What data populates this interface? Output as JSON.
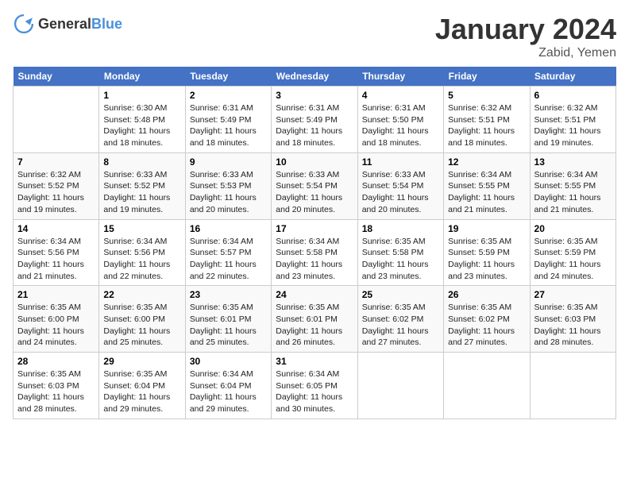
{
  "header": {
    "logo_general": "General",
    "logo_blue": "Blue",
    "month": "January 2024",
    "location": "Zabid, Yemen"
  },
  "days_of_week": [
    "Sunday",
    "Monday",
    "Tuesday",
    "Wednesday",
    "Thursday",
    "Friday",
    "Saturday"
  ],
  "weeks": [
    [
      {
        "day": "",
        "sunrise": "",
        "sunset": "",
        "daylight": ""
      },
      {
        "day": "1",
        "sunrise": "Sunrise: 6:30 AM",
        "sunset": "Sunset: 5:48 PM",
        "daylight": "Daylight: 11 hours and 18 minutes."
      },
      {
        "day": "2",
        "sunrise": "Sunrise: 6:31 AM",
        "sunset": "Sunset: 5:49 PM",
        "daylight": "Daylight: 11 hours and 18 minutes."
      },
      {
        "day": "3",
        "sunrise": "Sunrise: 6:31 AM",
        "sunset": "Sunset: 5:49 PM",
        "daylight": "Daylight: 11 hours and 18 minutes."
      },
      {
        "day": "4",
        "sunrise": "Sunrise: 6:31 AM",
        "sunset": "Sunset: 5:50 PM",
        "daylight": "Daylight: 11 hours and 18 minutes."
      },
      {
        "day": "5",
        "sunrise": "Sunrise: 6:32 AM",
        "sunset": "Sunset: 5:51 PM",
        "daylight": "Daylight: 11 hours and 18 minutes."
      },
      {
        "day": "6",
        "sunrise": "Sunrise: 6:32 AM",
        "sunset": "Sunset: 5:51 PM",
        "daylight": "Daylight: 11 hours and 19 minutes."
      }
    ],
    [
      {
        "day": "7",
        "sunrise": "Sunrise: 6:32 AM",
        "sunset": "Sunset: 5:52 PM",
        "daylight": "Daylight: 11 hours and 19 minutes."
      },
      {
        "day": "8",
        "sunrise": "Sunrise: 6:33 AM",
        "sunset": "Sunset: 5:52 PM",
        "daylight": "Daylight: 11 hours and 19 minutes."
      },
      {
        "day": "9",
        "sunrise": "Sunrise: 6:33 AM",
        "sunset": "Sunset: 5:53 PM",
        "daylight": "Daylight: 11 hours and 20 minutes."
      },
      {
        "day": "10",
        "sunrise": "Sunrise: 6:33 AM",
        "sunset": "Sunset: 5:54 PM",
        "daylight": "Daylight: 11 hours and 20 minutes."
      },
      {
        "day": "11",
        "sunrise": "Sunrise: 6:33 AM",
        "sunset": "Sunset: 5:54 PM",
        "daylight": "Daylight: 11 hours and 20 minutes."
      },
      {
        "day": "12",
        "sunrise": "Sunrise: 6:34 AM",
        "sunset": "Sunset: 5:55 PM",
        "daylight": "Daylight: 11 hours and 21 minutes."
      },
      {
        "day": "13",
        "sunrise": "Sunrise: 6:34 AM",
        "sunset": "Sunset: 5:55 PM",
        "daylight": "Daylight: 11 hours and 21 minutes."
      }
    ],
    [
      {
        "day": "14",
        "sunrise": "Sunrise: 6:34 AM",
        "sunset": "Sunset: 5:56 PM",
        "daylight": "Daylight: 11 hours and 21 minutes."
      },
      {
        "day": "15",
        "sunrise": "Sunrise: 6:34 AM",
        "sunset": "Sunset: 5:56 PM",
        "daylight": "Daylight: 11 hours and 22 minutes."
      },
      {
        "day": "16",
        "sunrise": "Sunrise: 6:34 AM",
        "sunset": "Sunset: 5:57 PM",
        "daylight": "Daylight: 11 hours and 22 minutes."
      },
      {
        "day": "17",
        "sunrise": "Sunrise: 6:34 AM",
        "sunset": "Sunset: 5:58 PM",
        "daylight": "Daylight: 11 hours and 23 minutes."
      },
      {
        "day": "18",
        "sunrise": "Sunrise: 6:35 AM",
        "sunset": "Sunset: 5:58 PM",
        "daylight": "Daylight: 11 hours and 23 minutes."
      },
      {
        "day": "19",
        "sunrise": "Sunrise: 6:35 AM",
        "sunset": "Sunset: 5:59 PM",
        "daylight": "Daylight: 11 hours and 23 minutes."
      },
      {
        "day": "20",
        "sunrise": "Sunrise: 6:35 AM",
        "sunset": "Sunset: 5:59 PM",
        "daylight": "Daylight: 11 hours and 24 minutes."
      }
    ],
    [
      {
        "day": "21",
        "sunrise": "Sunrise: 6:35 AM",
        "sunset": "Sunset: 6:00 PM",
        "daylight": "Daylight: 11 hours and 24 minutes."
      },
      {
        "day": "22",
        "sunrise": "Sunrise: 6:35 AM",
        "sunset": "Sunset: 6:00 PM",
        "daylight": "Daylight: 11 hours and 25 minutes."
      },
      {
        "day": "23",
        "sunrise": "Sunrise: 6:35 AM",
        "sunset": "Sunset: 6:01 PM",
        "daylight": "Daylight: 11 hours and 25 minutes."
      },
      {
        "day": "24",
        "sunrise": "Sunrise: 6:35 AM",
        "sunset": "Sunset: 6:01 PM",
        "daylight": "Daylight: 11 hours and 26 minutes."
      },
      {
        "day": "25",
        "sunrise": "Sunrise: 6:35 AM",
        "sunset": "Sunset: 6:02 PM",
        "daylight": "Daylight: 11 hours and 27 minutes."
      },
      {
        "day": "26",
        "sunrise": "Sunrise: 6:35 AM",
        "sunset": "Sunset: 6:02 PM",
        "daylight": "Daylight: 11 hours and 27 minutes."
      },
      {
        "day": "27",
        "sunrise": "Sunrise: 6:35 AM",
        "sunset": "Sunset: 6:03 PM",
        "daylight": "Daylight: 11 hours and 28 minutes."
      }
    ],
    [
      {
        "day": "28",
        "sunrise": "Sunrise: 6:35 AM",
        "sunset": "Sunset: 6:03 PM",
        "daylight": "Daylight: 11 hours and 28 minutes."
      },
      {
        "day": "29",
        "sunrise": "Sunrise: 6:35 AM",
        "sunset": "Sunset: 6:04 PM",
        "daylight": "Daylight: 11 hours and 29 minutes."
      },
      {
        "day": "30",
        "sunrise": "Sunrise: 6:34 AM",
        "sunset": "Sunset: 6:04 PM",
        "daylight": "Daylight: 11 hours and 29 minutes."
      },
      {
        "day": "31",
        "sunrise": "Sunrise: 6:34 AM",
        "sunset": "Sunset: 6:05 PM",
        "daylight": "Daylight: 11 hours and 30 minutes."
      },
      {
        "day": "",
        "sunrise": "",
        "sunset": "",
        "daylight": ""
      },
      {
        "day": "",
        "sunrise": "",
        "sunset": "",
        "daylight": ""
      },
      {
        "day": "",
        "sunrise": "",
        "sunset": "",
        "daylight": ""
      }
    ]
  ]
}
